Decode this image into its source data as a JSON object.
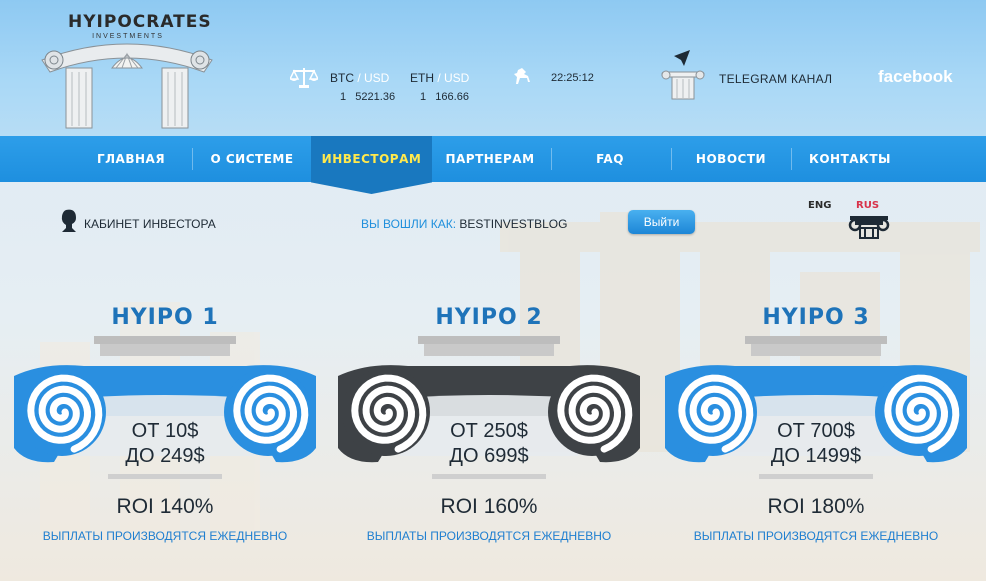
{
  "brand": {
    "title": "HYIPOCRATES",
    "subtitle": "INVESTMENTS"
  },
  "rates": [
    {
      "pair_base": "BTC",
      "pair_sep": " / ",
      "pair_quote": "USD",
      "amount": "1",
      "value": "5221.36"
    },
    {
      "pair_base": "ETH",
      "pair_sep": " / ",
      "pair_quote": "USD",
      "amount": "1",
      "value": "166.66"
    }
  ],
  "clock": "22:25:12",
  "telegram": {
    "label": "TELEGRAM КАНАЛ"
  },
  "facebook": {
    "label": "facebook"
  },
  "nav": {
    "items": [
      {
        "label": "ГЛАВНАЯ"
      },
      {
        "label": "О СИСТЕМЕ"
      },
      {
        "label": "ИНВЕСТОРАМ"
      },
      {
        "label": "ПАРТНЕРАМ"
      },
      {
        "label": "FAQ"
      },
      {
        "label": "НОВОСТИ"
      },
      {
        "label": "КОНТАКТЫ"
      }
    ],
    "active_index": 2
  },
  "cabinet": {
    "label": "КАБИНЕТ ИНВЕСТОРА"
  },
  "session": {
    "prefix": "ВЫ ВОШЛИ КАК: ",
    "user": "BESTINVESTBLOG",
    "logout_label": "Выйти"
  },
  "languages": {
    "eng": "ENG",
    "rus": "RUS",
    "active": "RUS"
  },
  "plans": [
    {
      "title": "HYIPO 1",
      "from": "ОТ 10$",
      "to": "ДО 249$",
      "roi": "ROI 140%",
      "note": "ВЫПЛАТЫ ПРОИЗВОДЯТСЯ ЕЖЕДНЕВНО",
      "color": "#2a8fe0"
    },
    {
      "title": "HYIPO 2",
      "from": "ОТ 250$",
      "to": "ДО 699$",
      "roi": "ROI 160%",
      "note": "ВЫПЛАТЫ ПРОИЗВОДЯТСЯ ЕЖЕДНЕВНО",
      "color": "#3e4246"
    },
    {
      "title": "HYIPO 3",
      "from": "ОТ 700$",
      "to": "ДО 1499$",
      "roi": "ROI 180%",
      "note": "ВЫПЛАТЫ ПРОИЗВОДЯТСЯ ЕЖЕДНЕВНО",
      "color": "#2a8fe0"
    }
  ],
  "colors": {
    "nav_bg": "#2196e3",
    "nav_active": "#1978bf",
    "nav_active_text": "#ffe94d",
    "accent_blue": "#1f8fdc",
    "plan_title": "#1e73b9"
  },
  "icons": [
    "scales-icon",
    "horse-icon",
    "telegram-icon",
    "column-icon",
    "investor-head-icon",
    "column-lang-icon",
    "arch-logo"
  ]
}
